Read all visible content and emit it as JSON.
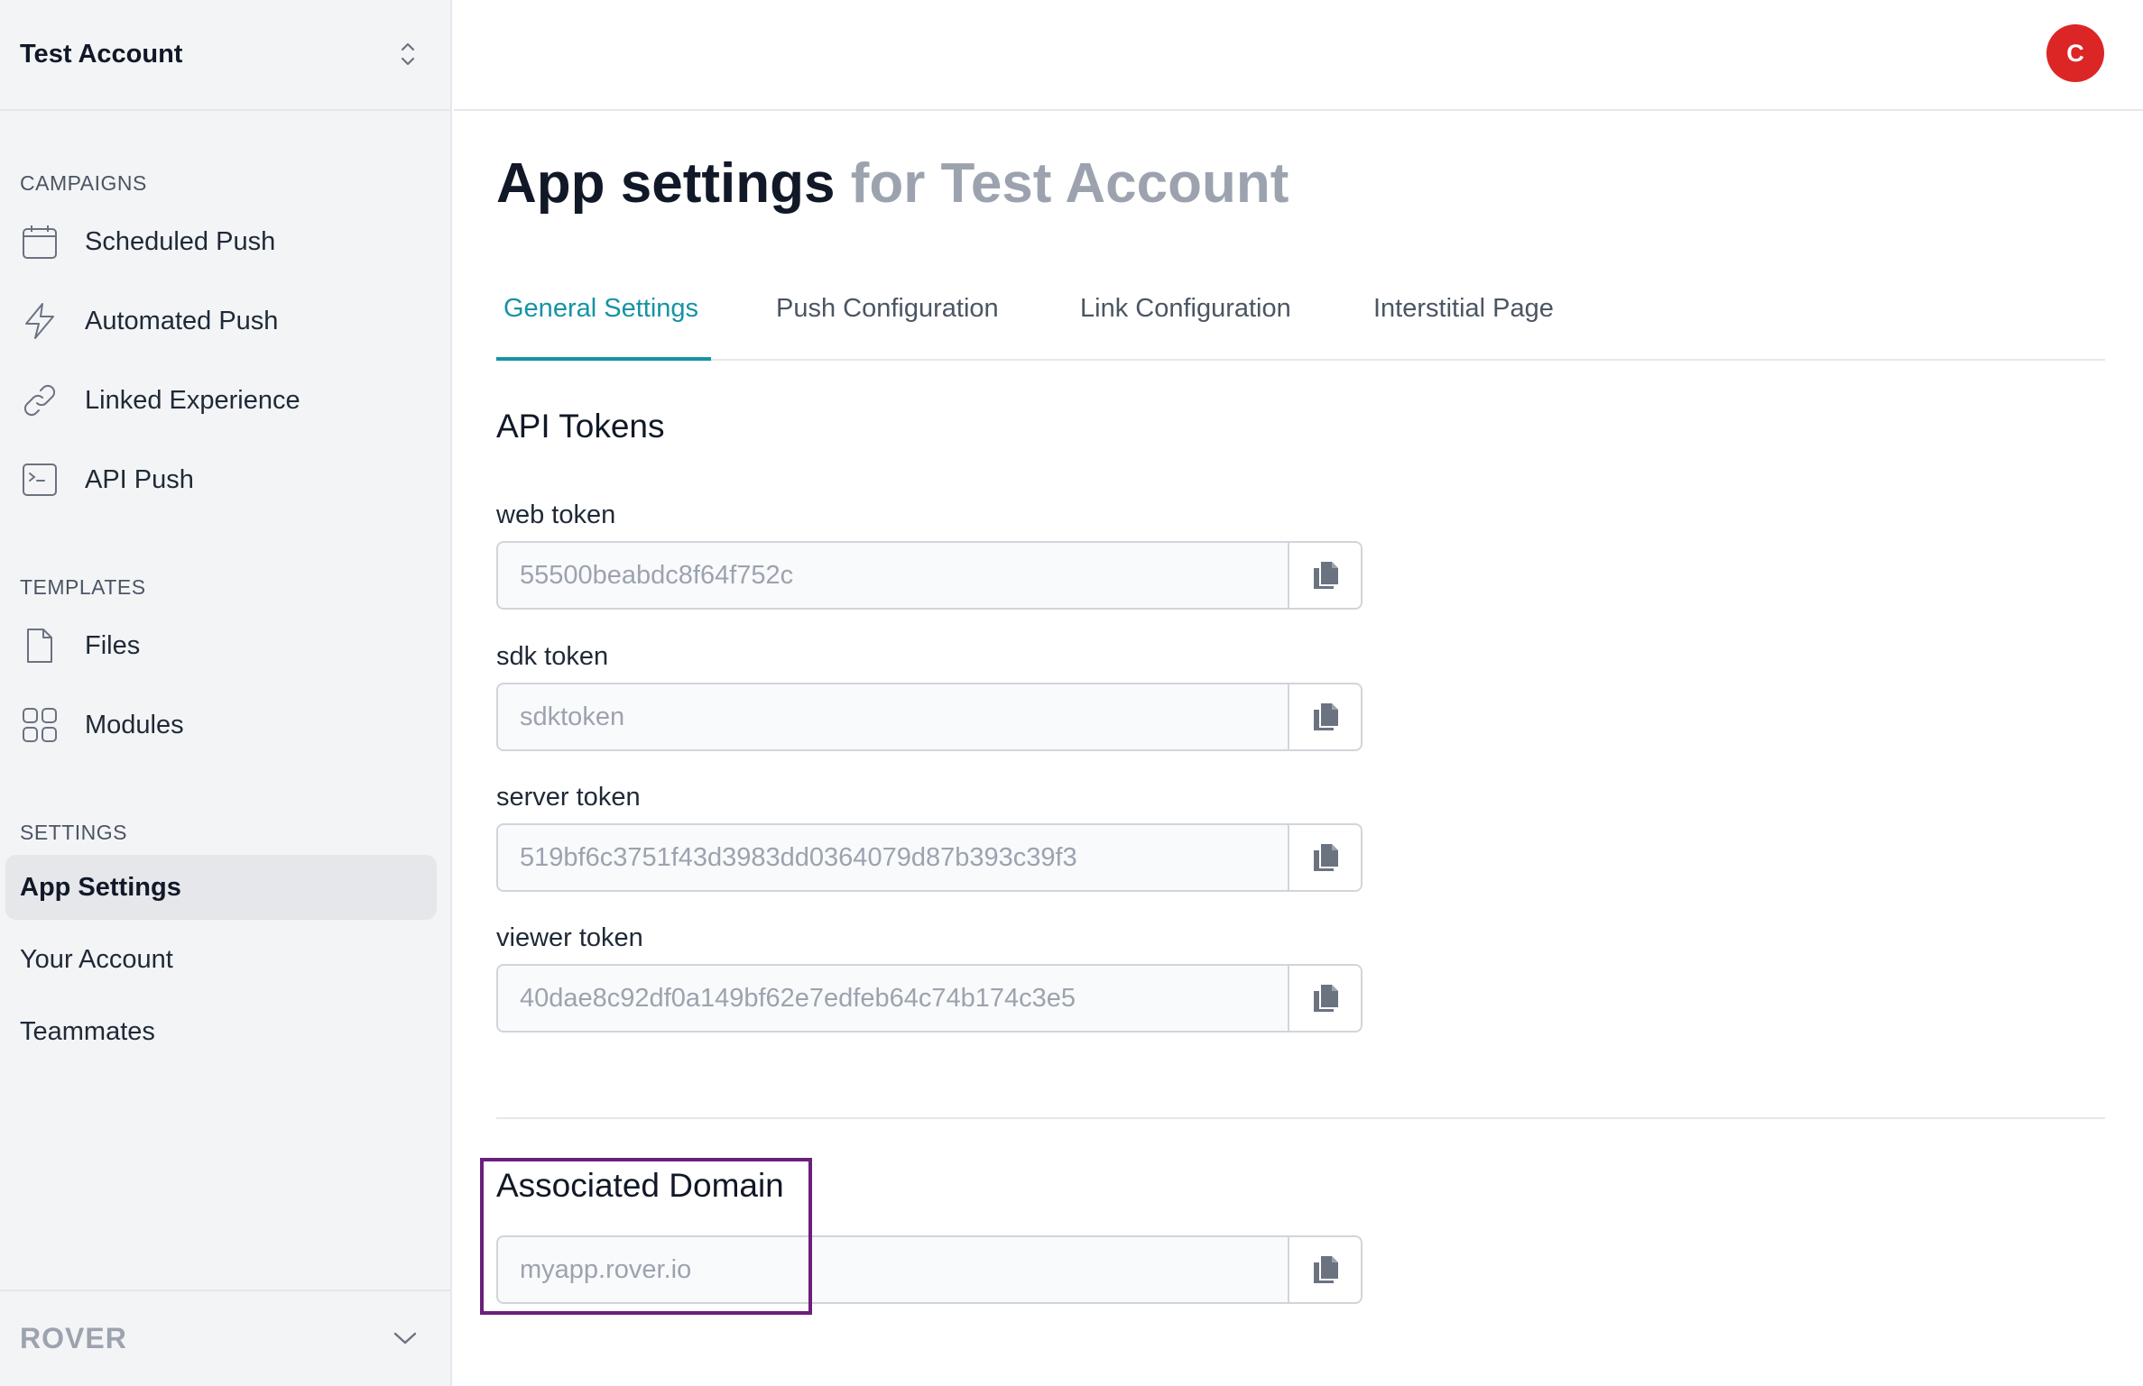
{
  "account": {
    "name": "Test Account"
  },
  "sidebar": {
    "campaigns_label": "CAMPAIGNS",
    "campaigns": [
      {
        "label": "Scheduled Push",
        "icon": "calendar-icon"
      },
      {
        "label": "Automated Push",
        "icon": "lightning-icon"
      },
      {
        "label": "Linked Experience",
        "icon": "link-icon"
      },
      {
        "label": "API Push",
        "icon": "terminal-icon"
      }
    ],
    "templates_label": "TEMPLATES",
    "templates": [
      {
        "label": "Files",
        "icon": "file-icon"
      },
      {
        "label": "Modules",
        "icon": "grid-icon"
      }
    ],
    "settings_label": "SETTINGS",
    "settings": [
      {
        "label": "App Settings",
        "active": true
      },
      {
        "label": "Your Account"
      },
      {
        "label": "Teammates"
      }
    ],
    "footer_brand": "ROVER"
  },
  "header": {
    "avatar_initial": "C"
  },
  "page": {
    "title": "App settings",
    "title_suffix": "for Test Account"
  },
  "tabs": [
    {
      "label": "General Settings",
      "active": true
    },
    {
      "label": "Push Configuration"
    },
    {
      "label": "Link Configuration"
    },
    {
      "label": "Interstitial Page"
    }
  ],
  "api_tokens": {
    "title": "API Tokens",
    "fields": [
      {
        "label": "web token",
        "value": "55500beabdc8f64f752c"
      },
      {
        "label": "sdk token",
        "value": "sdktoken"
      },
      {
        "label": "server token",
        "value": "519bf6c3751f43d3983dd0364079d87b393c39f3"
      },
      {
        "label": "viewer token",
        "value": "40dae8c92df0a149bf62e7edfeb64c74b174c3e5"
      }
    ]
  },
  "associated_domain": {
    "title": "Associated Domain",
    "value": "myapp.rover.io"
  },
  "colors": {
    "accent": "#1593a4",
    "avatar": "#dc2626",
    "highlight": "#6b1f7c"
  }
}
